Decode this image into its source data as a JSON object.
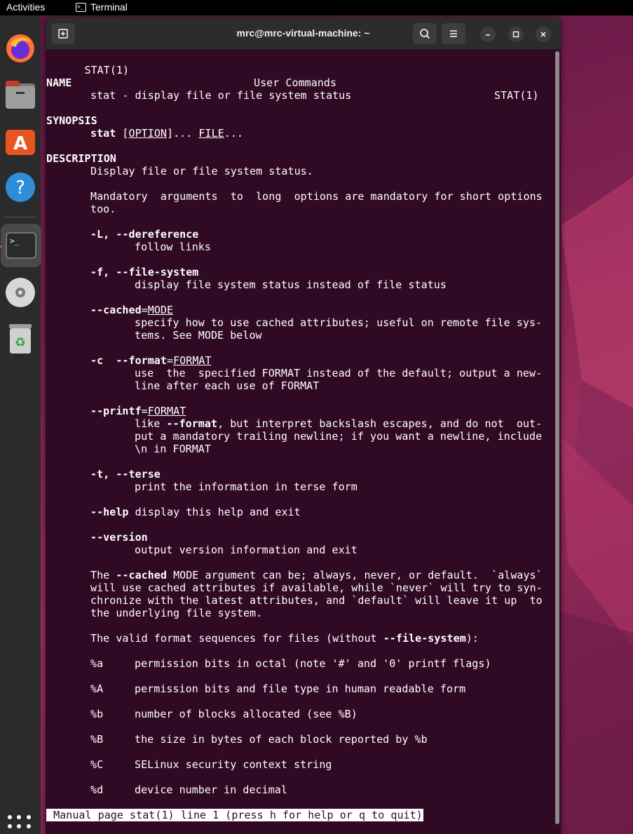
{
  "topbar": {
    "activities": "Activities",
    "app_name": "Terminal"
  },
  "window": {
    "title": "mrc@mrc-virtual-machine: ~"
  },
  "dock": {
    "items": [
      {
        "name": "firefox-icon"
      },
      {
        "name": "files-icon"
      },
      {
        "name": "app-center-icon"
      },
      {
        "name": "help-icon"
      },
      {
        "name": "terminal-icon"
      },
      {
        "name": "disc-icon"
      },
      {
        "name": "trash-icon"
      }
    ]
  },
  "man": {
    "header_left": "STAT(1)",
    "header_center": "User Commands",
    "header_right": "STAT(1)",
    "name_heading": "NAME",
    "name_text": "stat - display file or file system status",
    "synopsis_heading": "SYNOPSIS",
    "synopsis_cmd": "stat",
    "synopsis_option": "OPTION",
    "synopsis_mid": "]... ",
    "synopsis_file": "FILE",
    "synopsis_end": "...",
    "description_heading": "DESCRIPTION",
    "desc1": "Display file or file system status.",
    "desc2a": "Mandatory  arguments  to  long  options are mandatory for short options",
    "desc2b": "too.",
    "opt_L": "-L, --dereference",
    "opt_L_desc": "follow links",
    "opt_f": "-f, --file-system",
    "opt_f_desc": "display file system status instead of file status",
    "opt_cached": "--cached",
    "opt_cached_arg": "MODE",
    "opt_cached_desc1": "specify how to use cached attributes; useful on remote file sys-",
    "opt_cached_desc2": "tems. See MODE below",
    "opt_c": "-c  --format",
    "opt_c_arg": "FORMAT",
    "opt_c_desc1": "use  the  specified FORMAT instead of the default; output a new-",
    "opt_c_desc2": "line after each use of FORMAT",
    "opt_printf": "--printf",
    "opt_printf_arg": "FORMAT",
    "opt_printf_desc1a": "like ",
    "opt_printf_desc1b": "--format",
    "opt_printf_desc1c": ", but interpret backslash escapes, and do not  out-",
    "opt_printf_desc2": "put a mandatory trailing newline; if you want a newline, include",
    "opt_printf_desc3": "\\n in FORMAT",
    "opt_t": "-t, --terse",
    "opt_t_desc": "print the information in terse form",
    "opt_help": "--help",
    "opt_help_desc": " display this help and exit",
    "opt_version": "--version",
    "opt_version_desc": "output version information and exit",
    "mode1a": "The ",
    "mode1b": "--cached",
    "mode1c": " MODE argument can be; always, never, or default.  `always`",
    "mode2": "will use cached attributes if available, while `never` will try to syn-",
    "mode3": "chronize with the latest attributes, and `default` will leave it up  to",
    "mode4": "the underlying file system.",
    "valid_a": "The valid format sequences for files (without ",
    "valid_b": "--file-system",
    "valid_c": "):",
    "formats": [
      {
        "code": "%a",
        "desc": "permission bits in octal (note '#' and '0' printf flags)"
      },
      {
        "code": "%A",
        "desc": "permission bits and file type in human readable form"
      },
      {
        "code": "%b",
        "desc": "number of blocks allocated (see %B)"
      },
      {
        "code": "%B",
        "desc": "the size in bytes of each block reported by %b"
      },
      {
        "code": "%C",
        "desc": "SELinux security context string"
      },
      {
        "code": "%d",
        "desc": "device number in decimal"
      }
    ],
    "status_line": " Manual page stat(1) line 1 (press h for help or q to quit)"
  }
}
